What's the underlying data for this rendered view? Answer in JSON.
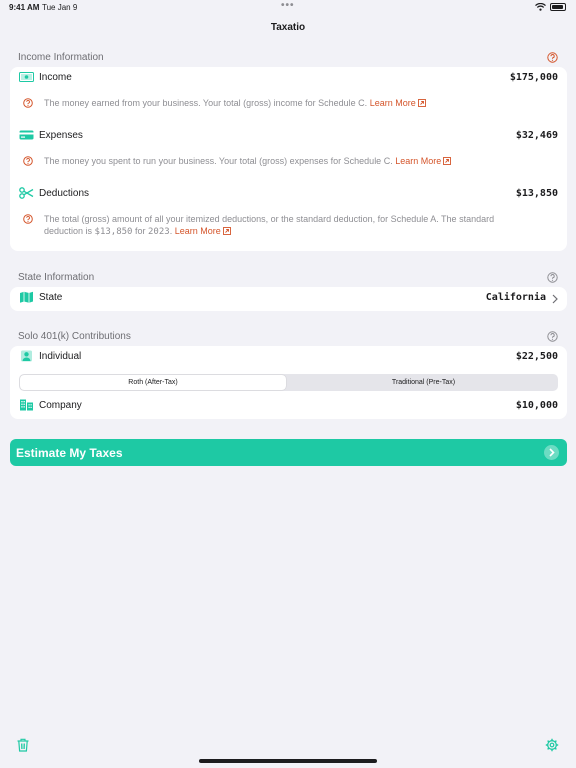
{
  "status_bar": {
    "time": "9:41 AM",
    "date": "Tue Jan 9",
    "dots": "•••"
  },
  "nav": {
    "title": "Taxatio"
  },
  "colors": {
    "accent": "#1ec9a4",
    "link": "#d4552b",
    "help": "#d4552b"
  },
  "income_section": {
    "header": "Income Information",
    "rows": [
      {
        "label": "Income",
        "value": "$175,000",
        "icon": "cash-icon",
        "description": "The money earned from your business. Your total (gross) income for Schedule C.",
        "learn_more": "Learn More"
      },
      {
        "label": "Expenses",
        "value": "$32,469",
        "icon": "credit-card-icon",
        "description": "The money you spent to run your business. Your total (gross) expenses for Schedule C.",
        "learn_more": "Learn More"
      },
      {
        "label": "Deductions",
        "value": "$13,850",
        "icon": "scissors-icon",
        "description_line1": "The total (gross) amount of all your itemized deductions, or the standard deduction, for Schedule A. The standard",
        "description_pre": "deduction is ",
        "description_amount": "$13,850",
        "description_mid": " for ",
        "description_year": "2023",
        "description_end": ".",
        "learn_more": "Learn More"
      }
    ]
  },
  "state_section": {
    "header": "State Information",
    "row": {
      "label": "State",
      "value": "California",
      "icon": "map-icon"
    }
  },
  "solo_section": {
    "header": "Solo 401(k) Contributions",
    "individual": {
      "label": "Individual",
      "value": "$22,500",
      "icon": "person-icon"
    },
    "segments": [
      {
        "label": "Roth (After-Tax)",
        "selected": true
      },
      {
        "label": "Traditional (Pre-Tax)",
        "selected": false
      }
    ],
    "company": {
      "label": "Company",
      "value": "$10,000",
      "icon": "building-icon"
    }
  },
  "cta": {
    "label": "Estimate My Taxes",
    "icon": "chevron-right-circle-icon"
  },
  "bottom_bar": {
    "left_icon": "trash-icon",
    "right_icon": "gear-icon"
  }
}
